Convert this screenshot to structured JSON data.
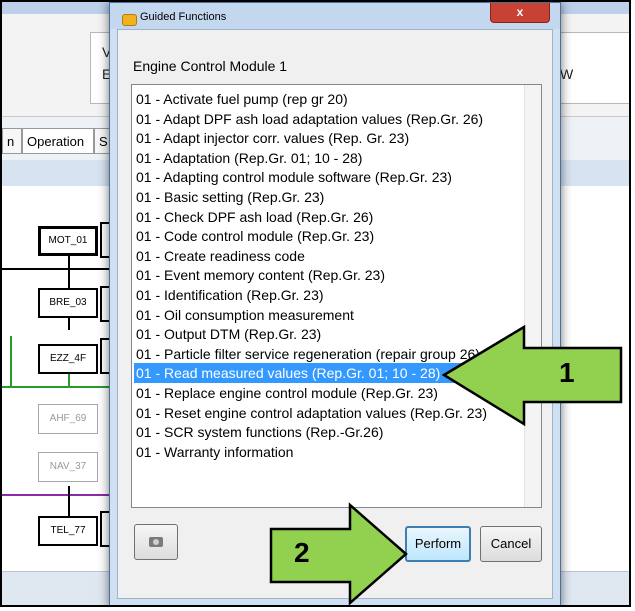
{
  "background": {
    "header_letters": [
      "V",
      "E",
      "W"
    ],
    "tabs": [
      "n",
      "Operation",
      "S"
    ],
    "nodes": [
      "MOT_01",
      "BRE_03",
      "EZZ_4F",
      "AHF_69",
      "NAV_37",
      "TEL_77"
    ]
  },
  "dialog": {
    "title": "Guided Functions",
    "close_glyph": "x",
    "module_name": "Engine Control Module 1",
    "items": [
      "01 - Activate fuel pump (rep gr 20)",
      "01 - Adapt DPF ash load adaptation values (Rep.Gr. 26)",
      "01 - Adapt injector corr. values (Rep. Gr. 23)",
      "01 - Adaptation (Rep.Gr. 01; 10 - 28)",
      "01 - Adapting control module software (Rep.Gr. 23)",
      "01 - Basic setting (Rep.Gr. 23)",
      "01 - Check DPF ash load (Rep.Gr. 26)",
      "01 - Code control module (Rep.Gr. 23)",
      "01 - Create readiness code",
      "01 - Event memory content (Rep.Gr. 23)",
      "01 - Identification (Rep.Gr. 23)",
      "01 - Oil consumption measurement",
      "01 - Output DTM (Rep.Gr. 23)",
      "01 - Particle filter service regeneration (repair group 26)",
      "01 - Read measured values (Rep.Gr. 01; 10 - 28)",
      "01 - Replace engine control module (Rep.Gr. 23)",
      "01 - Reset engine control adaptation values (Rep.Gr. 23)",
      "01 - SCR system functions (Rep.-Gr.26)",
      "01 - Warranty information"
    ],
    "selected_index": 14,
    "perform_label": "Perform",
    "cancel_label": "Cancel"
  },
  "annotations": {
    "arrow_1_label": "1",
    "arrow_2_label": "2",
    "arrow_color": "#92d050"
  },
  "colors": {
    "selection": "#3399ff",
    "close_button": "#c74234",
    "bus_green": "#2a9a2a",
    "bus_purple": "#8b2ba8"
  }
}
